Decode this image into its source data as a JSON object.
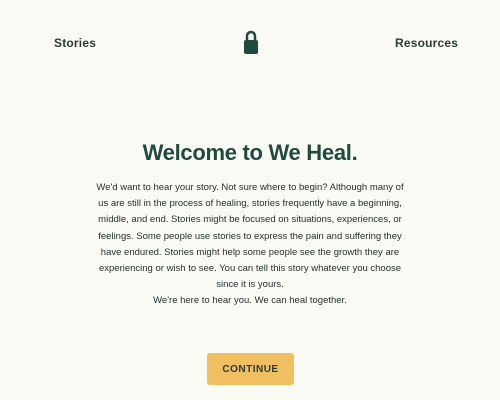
{
  "nav": {
    "stories_label": "Stories",
    "resources_label": "Resources",
    "logo_icon": "lock-icon"
  },
  "main": {
    "title": "Welcome to We Heal.",
    "body": "We'd want to hear your story. Not sure where to begin? Although many of us are still in the process of healing, stories frequently have a beginning, middle, and end. Stories might be focused on situations, experiences, or feelings. Some people use stories to express the pain and suffering they have endured. Stories might help some people see the growth they are experiencing or wish to see. You can tell this story whatever you choose since it is yours.",
    "closing": "We're here to hear you. We can heal together.",
    "continue_label": "CONTINUE"
  },
  "colors": {
    "background": "#fbfbf6",
    "title": "#1f4a3d",
    "button": "#f0c060",
    "lock": "#1f4a3d"
  }
}
